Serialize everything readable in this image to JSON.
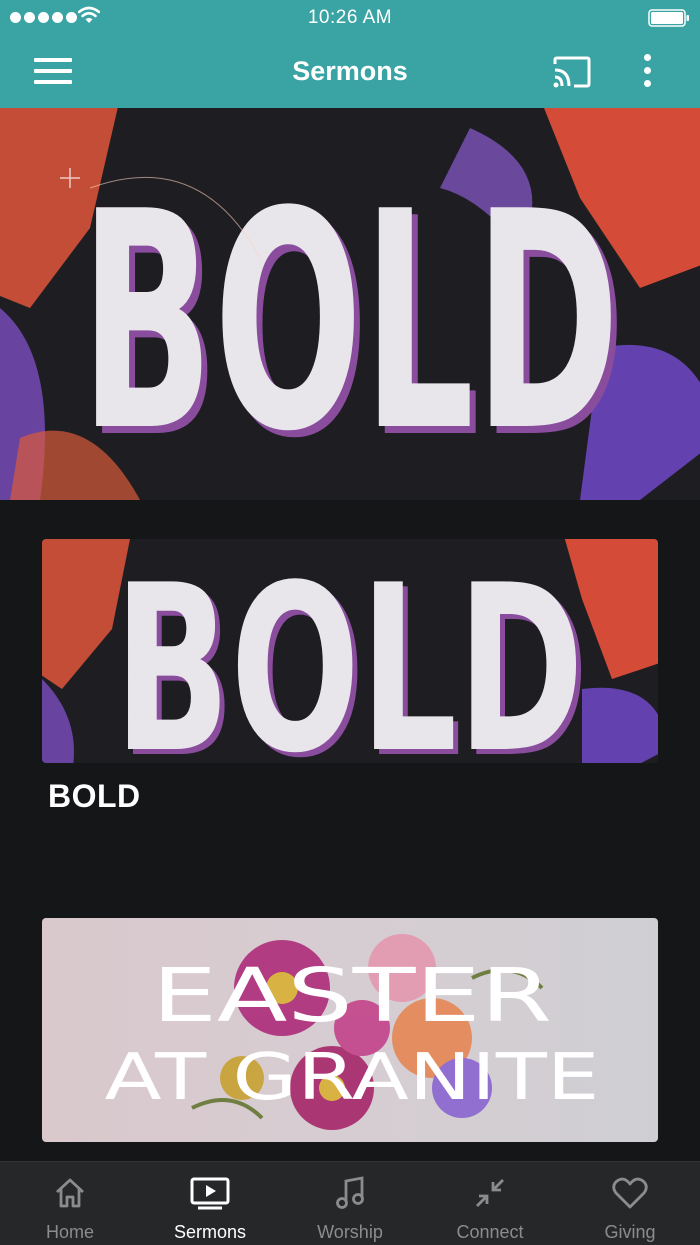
{
  "status_bar": {
    "time": "10:26 AM"
  },
  "app_bar": {
    "title": "Sermons"
  },
  "hero": {
    "art_text": "BOLD"
  },
  "cards": [
    {
      "art_text": "BOLD",
      "title": "BOLD"
    },
    {
      "art_line1": "EASTER",
      "art_line2": "AT GRANITE",
      "title": ""
    }
  ],
  "tabs": [
    {
      "label": "Home",
      "icon": "home-icon",
      "active": false
    },
    {
      "label": "Sermons",
      "icon": "tv-play-icon",
      "active": true
    },
    {
      "label": "Worship",
      "icon": "music-note-icon",
      "active": false
    },
    {
      "label": "Connect",
      "icon": "collapse-arrows-icon",
      "active": false
    },
    {
      "label": "Giving",
      "icon": "heart-icon",
      "active": false
    }
  ],
  "colors": {
    "accent": "#3aa3a3",
    "background": "#151618",
    "tab_bar": "#262729",
    "tab_inactive": "#8c8c8e"
  }
}
